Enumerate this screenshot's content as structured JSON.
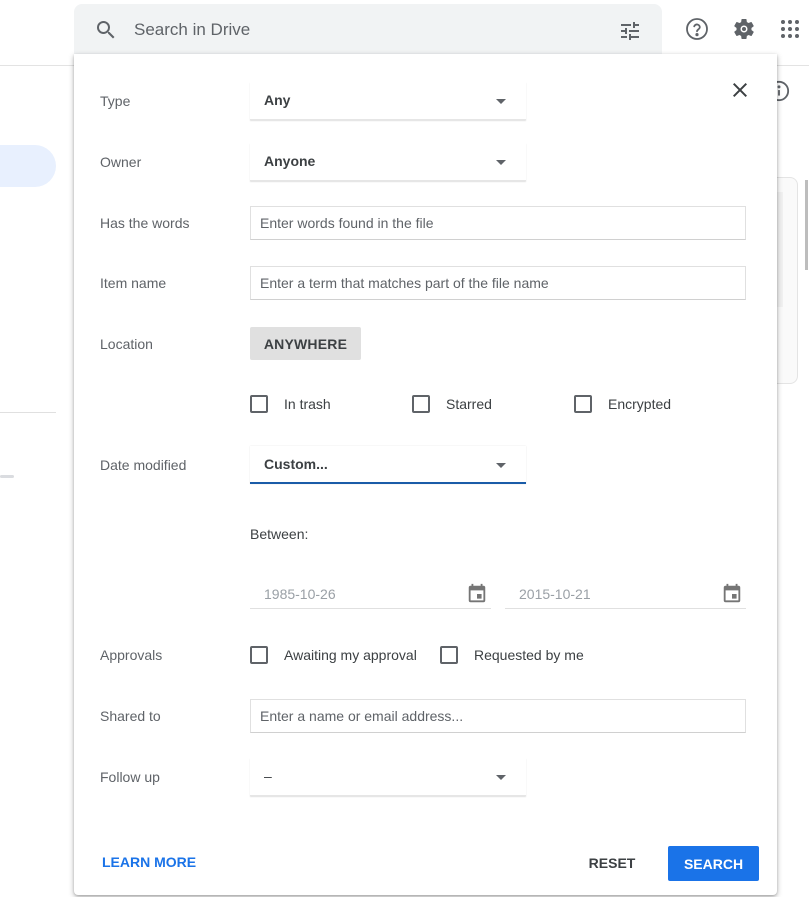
{
  "header": {
    "search_placeholder": "Search in Drive",
    "icons": [
      "search-icon",
      "tune-icon",
      "help-icon",
      "settings-icon",
      "apps-icon",
      "info-icon"
    ]
  },
  "dialog": {
    "close_icon": "close-icon",
    "type": {
      "label": "Type",
      "value": "Any"
    },
    "owner": {
      "label": "Owner",
      "value": "Anyone"
    },
    "has_words": {
      "label": "Has the words",
      "placeholder": "Enter words found in the file",
      "value": ""
    },
    "item_name": {
      "label": "Item name",
      "placeholder": "Enter a term that matches part of the file name",
      "value": ""
    },
    "location": {
      "label": "Location",
      "button": "ANYWHERE",
      "checkboxes": [
        {
          "label": "In trash",
          "checked": false
        },
        {
          "label": "Starred",
          "checked": false
        },
        {
          "label": "Encrypted",
          "checked": false
        }
      ]
    },
    "date_modified": {
      "label": "Date modified",
      "value": "Custom...",
      "between_label": "Between:",
      "from": "1985-10-26",
      "to": "2015-10-21"
    },
    "approvals": {
      "label": "Approvals",
      "checkboxes": [
        {
          "label": "Awaiting my approval",
          "checked": false
        },
        {
          "label": "Requested by me",
          "checked": false
        }
      ]
    },
    "shared_to": {
      "label": "Shared to",
      "placeholder": "Enter a name or email address...",
      "value": ""
    },
    "follow_up": {
      "label": "Follow up",
      "value": "–"
    },
    "footer": {
      "learn_more": "LEARN MORE",
      "reset": "RESET",
      "search": "SEARCH"
    }
  },
  "colors": {
    "accent": "#1a73e8",
    "focus_underline": "#1a5ca8",
    "search_bar_bg": "#f1f3f4"
  }
}
